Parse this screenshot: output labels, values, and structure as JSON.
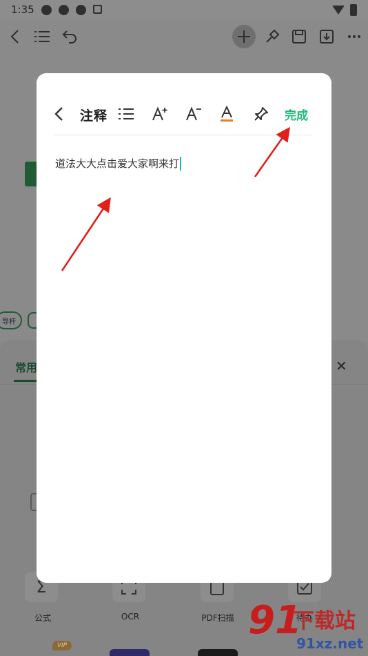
{
  "status_bar": {
    "time": "1:35"
  },
  "bottom_panel": {
    "tab_label": "常用",
    "tools": [
      {
        "label": "公式"
      },
      {
        "label": "OCR"
      },
      {
        "label": "PDF扫描"
      },
      {
        "label": "待办"
      }
    ],
    "vip_badge": "VIP"
  },
  "mind_map": {
    "pill_text": "导杆"
  },
  "modal": {
    "title": "注释",
    "done_label": "完成",
    "content_text": "道法大大点击爱大家啊来打",
    "text_color_accent": "#f07a1e",
    "done_color": "#1eb97a"
  },
  "watermark": {
    "logo_number": "91",
    "logo_text": "下载站",
    "url": "91xz.net"
  }
}
